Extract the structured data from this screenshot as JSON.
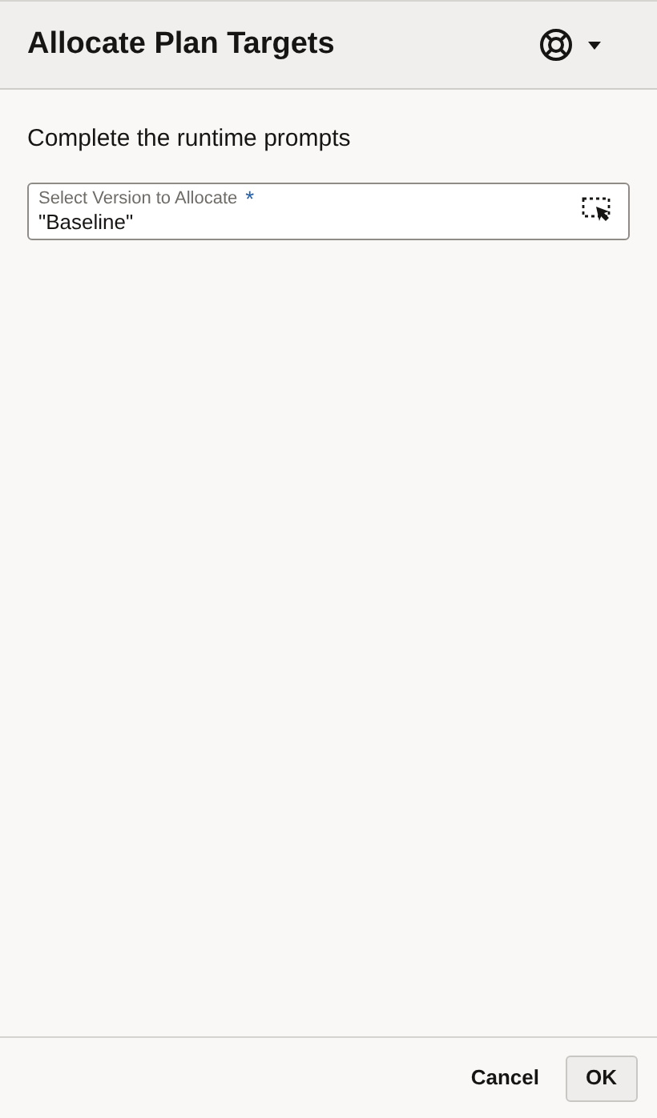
{
  "header": {
    "title": "Allocate Plan Targets"
  },
  "instructions": "Complete the runtime prompts",
  "prompts": [
    {
      "label": "Select Version to Allocate",
      "required_mark": "*",
      "value": "\"Baseline\""
    }
  ],
  "buttons": [
    {
      "label": "Cancel",
      "kind": "text"
    },
    {
      "label": "OK",
      "kind": "outlined"
    }
  ]
}
